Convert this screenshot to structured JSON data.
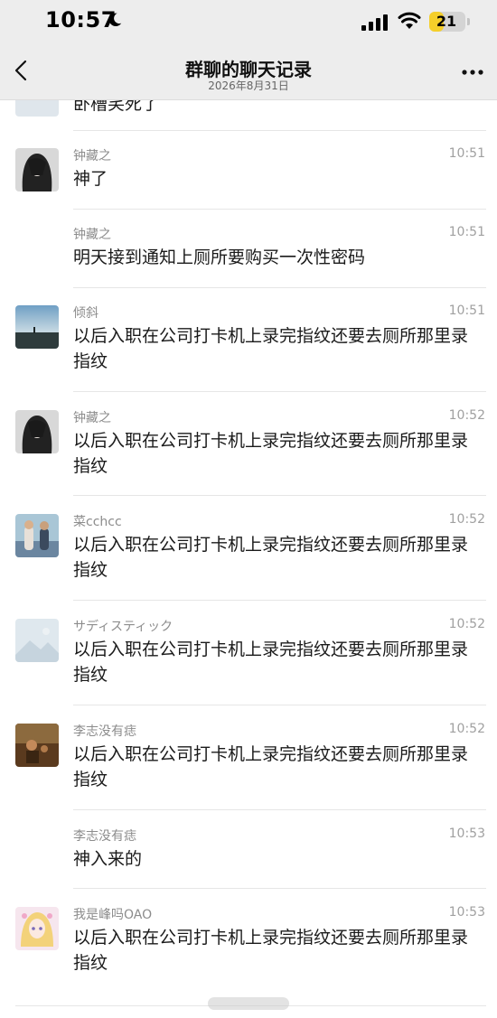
{
  "status_bar": {
    "time": "10:57",
    "battery": "21",
    "battery_level_percent": 21
  },
  "nav": {
    "title": "群聊的聊天记录",
    "subtitle": "2026年8月31日"
  },
  "partial_message": {
    "text": "卧槽笑死了"
  },
  "messages": [
    {
      "sender": "钟藏之",
      "time": "10:51",
      "text": "神了",
      "avatar": "girl-hair-avatar"
    },
    {
      "sender": "钟藏之",
      "time": "10:51",
      "text": "明天接到通知上厕所要购买一次性密码",
      "avatar": ""
    },
    {
      "sender": "倾斜",
      "time": "10:51",
      "text": "以后入职在公司打卡机上录完指纹还要去厕所那里录指纹",
      "avatar": "sunset-avatar"
    },
    {
      "sender": "钟藏之",
      "time": "10:52",
      "text": "以后入职在公司打卡机上录完指纹还要去厕所那里录指纹",
      "avatar": "girl-hair-avatar"
    },
    {
      "sender": "菜cchcc",
      "time": "10:52",
      "text": "以后入职在公司打卡机上录完指纹还要去厕所那里录指纹",
      "avatar": "people-avatar"
    },
    {
      "sender": "サディスティック",
      "time": "10:52",
      "text": "以后入职在公司打卡机上录完指纹还要去厕所那里录指纹",
      "avatar": "placeholder-avatar"
    },
    {
      "sender": "李志没有痣",
      "time": "10:52",
      "text": "以后入职在公司打卡机上录完指纹还要去厕所那里录指纹",
      "avatar": "painting-avatar"
    },
    {
      "sender": "李志没有痣",
      "time": "10:53",
      "text": "神入来的",
      "avatar": ""
    },
    {
      "sender": "我是峰吗OAO",
      "time": "10:53",
      "text": "以后入职在公司打卡机上录完指纹还要去厕所那里录指纹",
      "avatar": "anime-avatar"
    }
  ],
  "colors": {
    "nav_bg": "#ededed",
    "battery": "#f5cf2a",
    "meta_text": "#8c8c8c"
  }
}
